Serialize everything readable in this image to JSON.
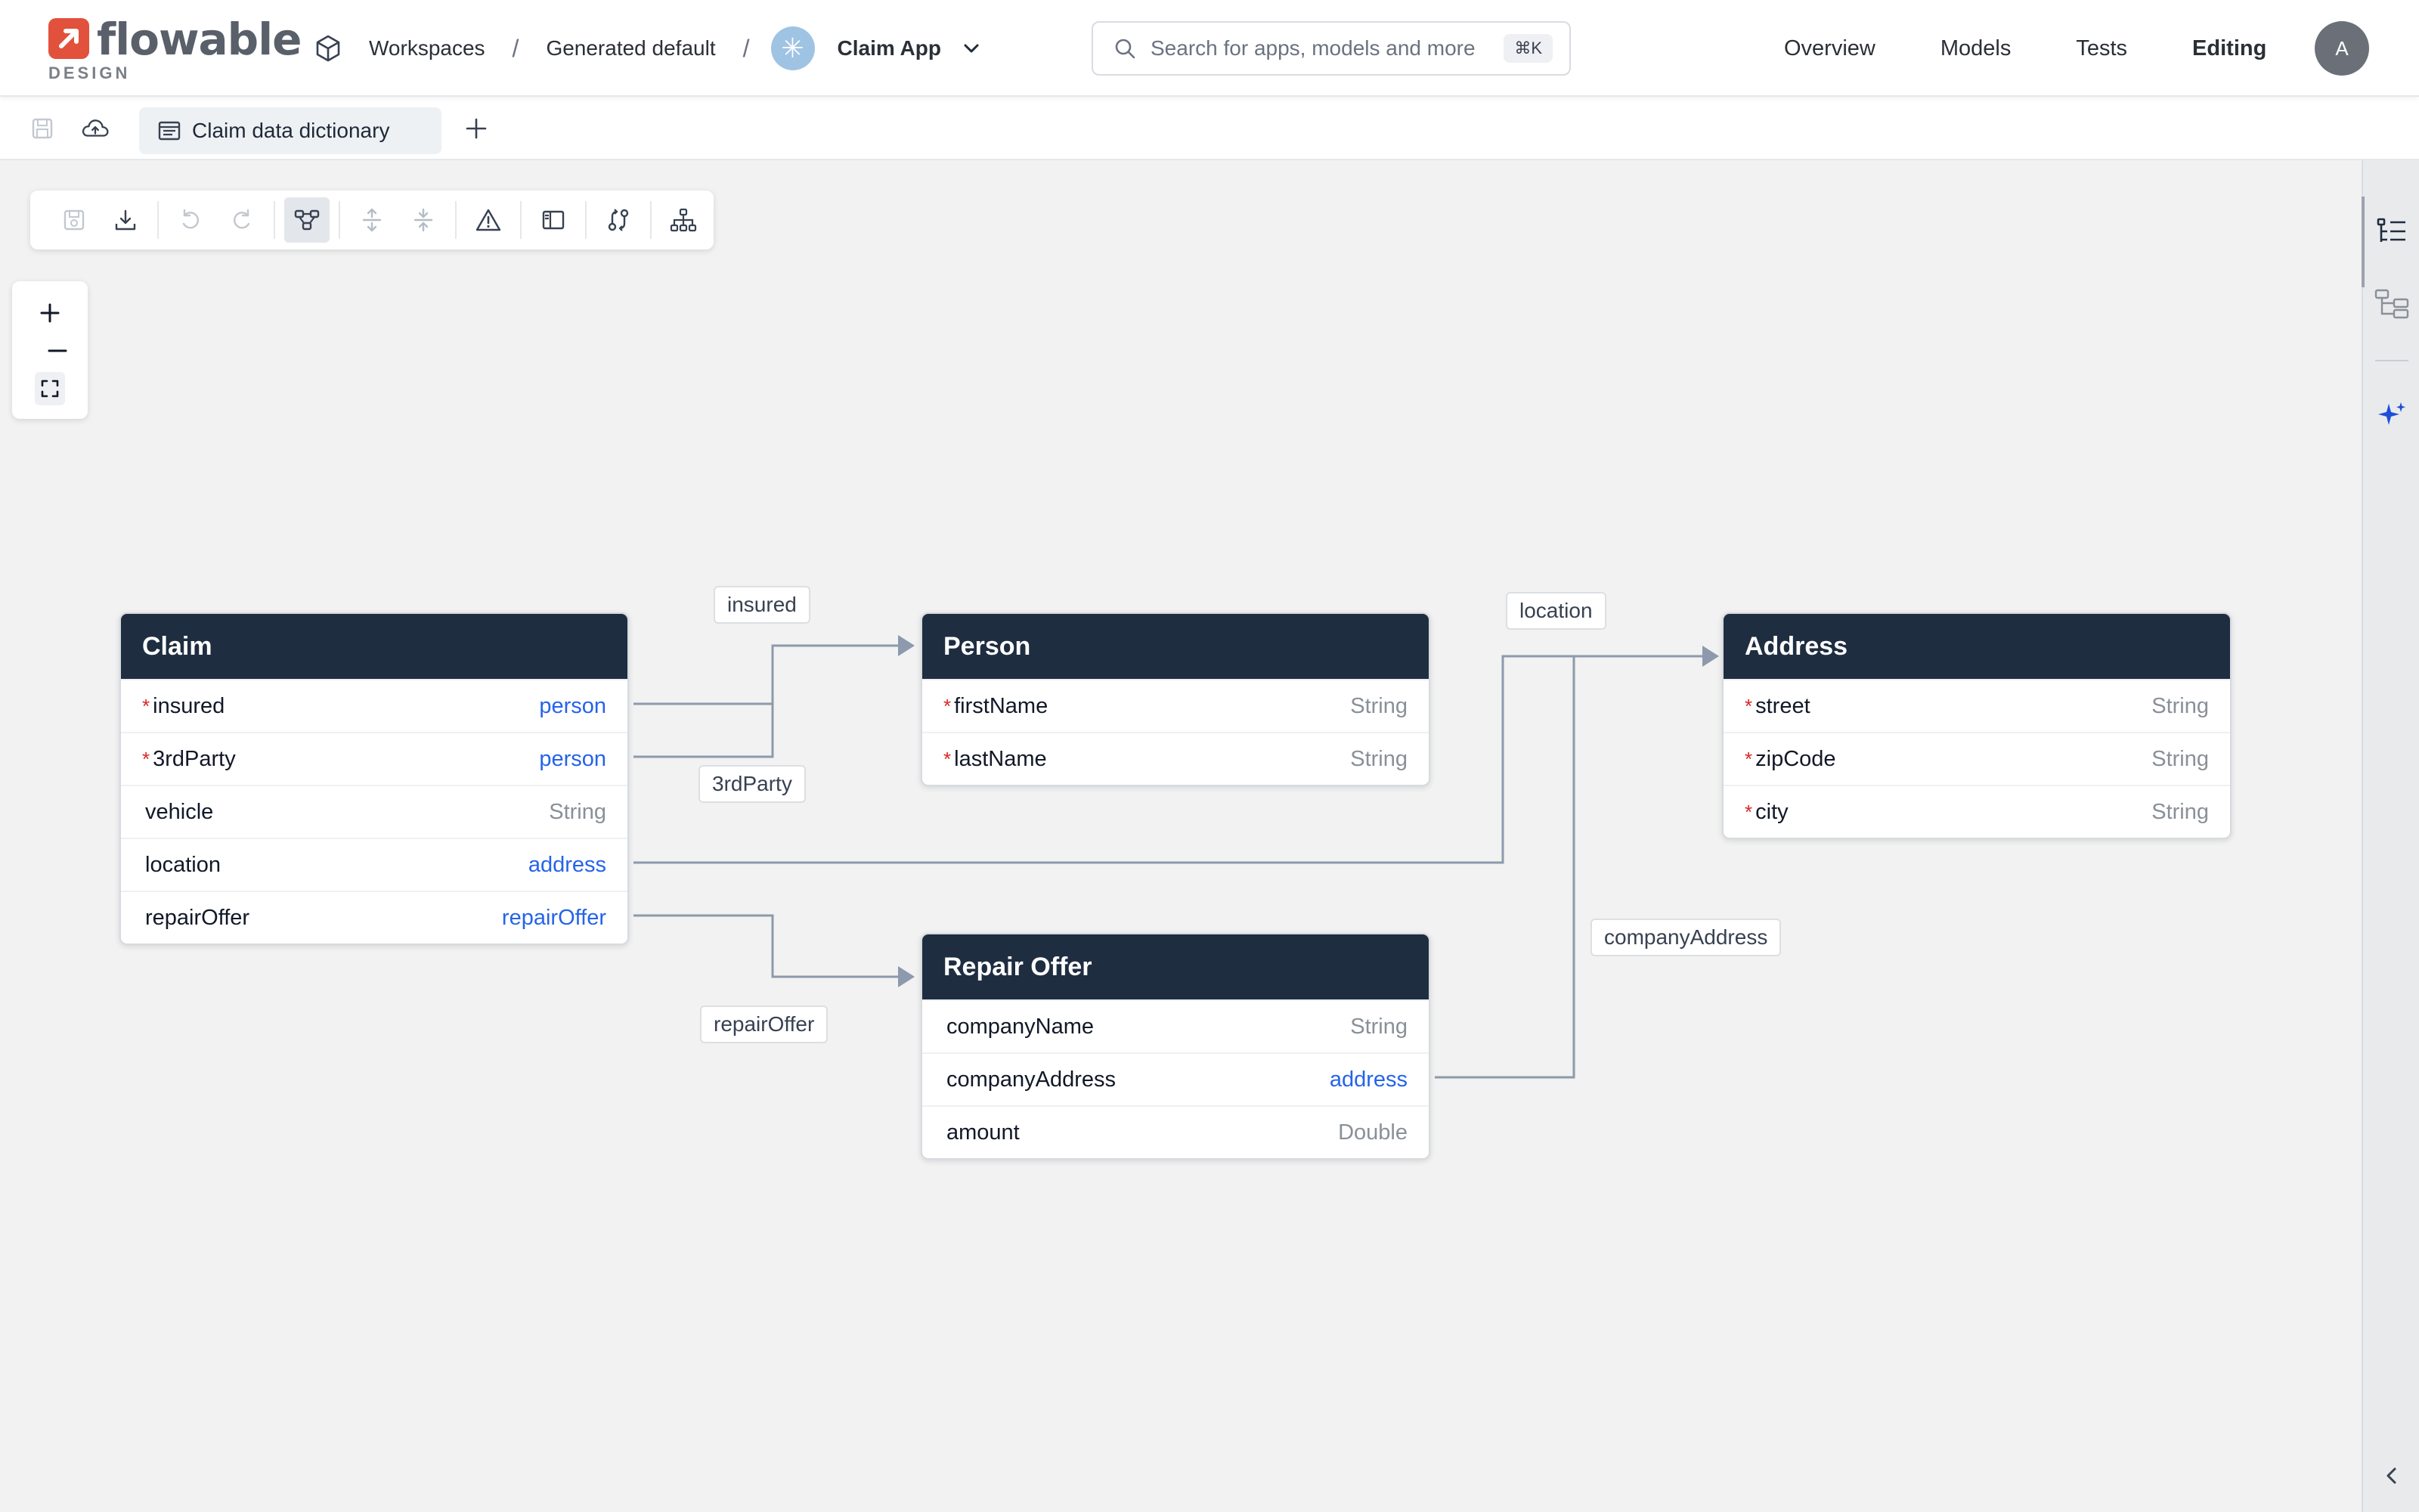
{
  "brand": {
    "name": "flowable",
    "sub": "DESIGN",
    "color": "#e2513b"
  },
  "breadcrumb": {
    "workspaces": "Workspaces",
    "workspace": "Generated default",
    "app": "Claim App"
  },
  "search": {
    "placeholder": "Search for apps, models and more",
    "shortcut": "⌘K"
  },
  "nav": {
    "items": [
      "Overview",
      "Models",
      "Tests",
      "Editing"
    ],
    "active": "Editing"
  },
  "user": {
    "initial": "A"
  },
  "tabs": [
    {
      "label": "Claim data dictionary"
    }
  ],
  "entities": {
    "claim": {
      "title": "Claim",
      "fields": [
        {
          "name": "insured",
          "type": "person",
          "required": "*"
        },
        {
          "name": "3rdParty",
          "type": "person",
          "required": "*"
        },
        {
          "name": "vehicle",
          "type": "String",
          "required": ""
        },
        {
          "name": "location",
          "type": "address",
          "required": ""
        },
        {
          "name": "repairOffer",
          "type": "repairOffer",
          "required": ""
        }
      ]
    },
    "person": {
      "title": "Person",
      "fields": [
        {
          "name": "firstName",
          "type": "String",
          "required": "*"
        },
        {
          "name": "lastName",
          "type": "String",
          "required": "*"
        }
      ]
    },
    "address": {
      "title": "Address",
      "fields": [
        {
          "name": "street",
          "type": "String",
          "required": "*"
        },
        {
          "name": "zipCode",
          "type": "String",
          "required": "*"
        },
        {
          "name": "city",
          "type": "String",
          "required": "*"
        }
      ]
    },
    "repair_offer": {
      "title": "Repair Offer",
      "fields": [
        {
          "name": "companyName",
          "type": "String",
          "required": ""
        },
        {
          "name": "companyAddress",
          "type": "address",
          "required": ""
        },
        {
          "name": "amount",
          "type": "Double",
          "required": ""
        }
      ]
    }
  },
  "edges": {
    "insured": "insured",
    "third_party": "3rdParty",
    "location": "location",
    "repair_offer": "repairOffer",
    "company_address": "companyAddress"
  },
  "colors": {
    "entity_header": "#1f2d41",
    "link_type": "#2563eb",
    "required": "#dc2626",
    "edge": "#8d99ad"
  }
}
